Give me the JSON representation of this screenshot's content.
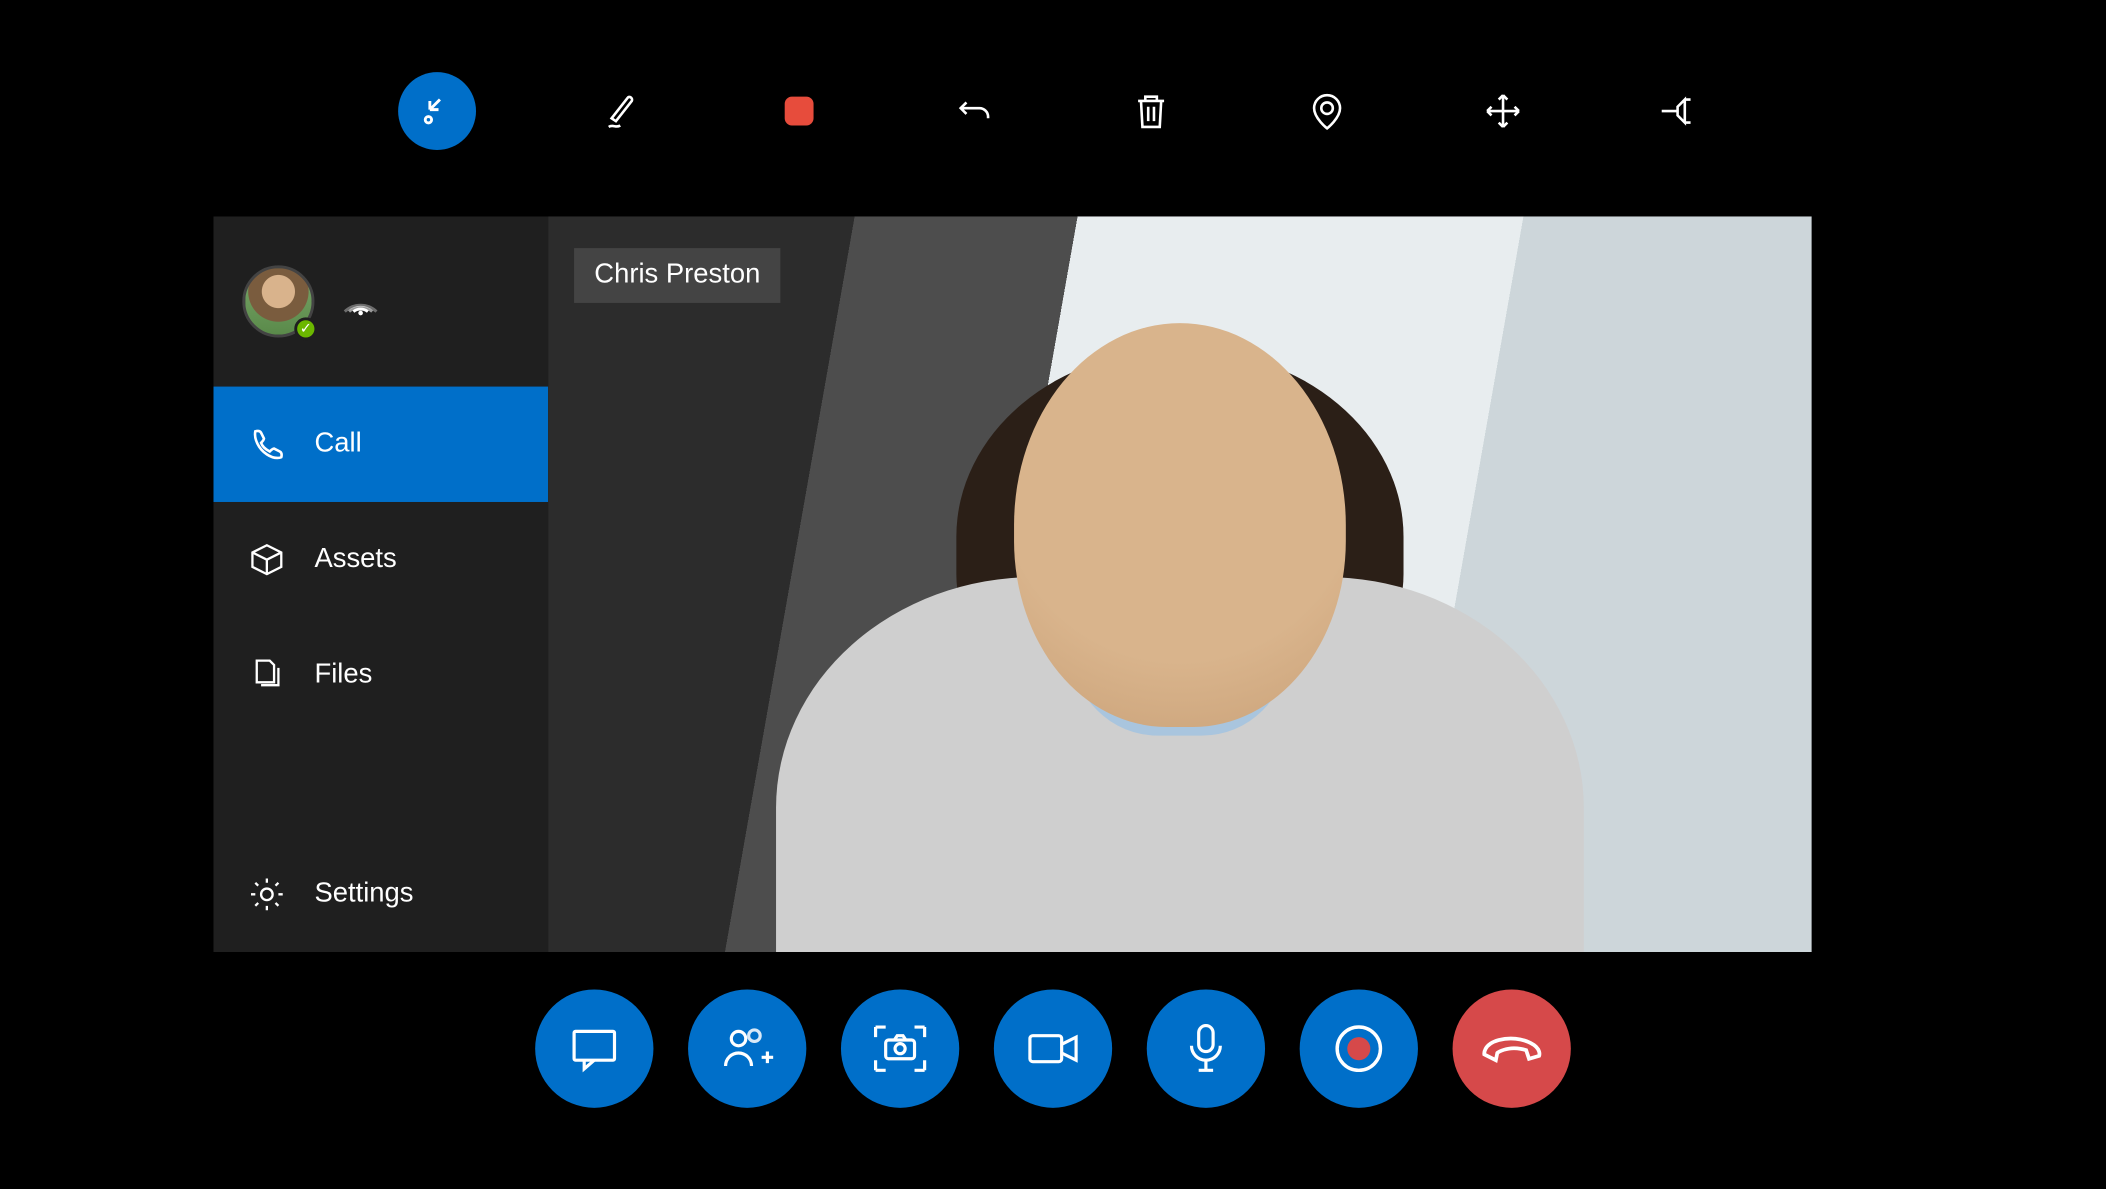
{
  "topToolbar": {
    "items": [
      {
        "name": "exit-fullscreen-icon",
        "active": true
      },
      {
        "name": "ink-icon"
      },
      {
        "name": "stop-record-icon"
      },
      {
        "name": "undo-icon"
      },
      {
        "name": "delete-icon"
      },
      {
        "name": "location-icon"
      },
      {
        "name": "move-icon"
      },
      {
        "name": "pin-icon"
      }
    ]
  },
  "sidebar": {
    "status": "online",
    "items": [
      {
        "key": "call",
        "label": "Call",
        "icon": "phone-icon",
        "active": true
      },
      {
        "key": "assets",
        "label": "Assets",
        "icon": "package-icon",
        "active": false
      },
      {
        "key": "files",
        "label": "Files",
        "icon": "files-icon",
        "active": false
      },
      {
        "key": "settings",
        "label": "Settings",
        "icon": "gear-icon",
        "active": false
      }
    ]
  },
  "call": {
    "participantName": "Chris Preston"
  },
  "callBar": {
    "buttons": [
      {
        "name": "chat-button",
        "icon": "chat-icon"
      },
      {
        "name": "add-people-button",
        "icon": "add-person-icon"
      },
      {
        "name": "screenshot-button",
        "icon": "camera-capture-icon"
      },
      {
        "name": "video-button",
        "icon": "video-icon"
      },
      {
        "name": "mic-button",
        "icon": "microphone-icon"
      },
      {
        "name": "record-button",
        "icon": "record-icon"
      },
      {
        "name": "hangup-button",
        "icon": "hangup-icon",
        "hangup": true
      }
    ]
  },
  "colors": {
    "accent": "#006fc9",
    "hangup": "#d6494a",
    "sidebar": "#1f1f1f"
  }
}
